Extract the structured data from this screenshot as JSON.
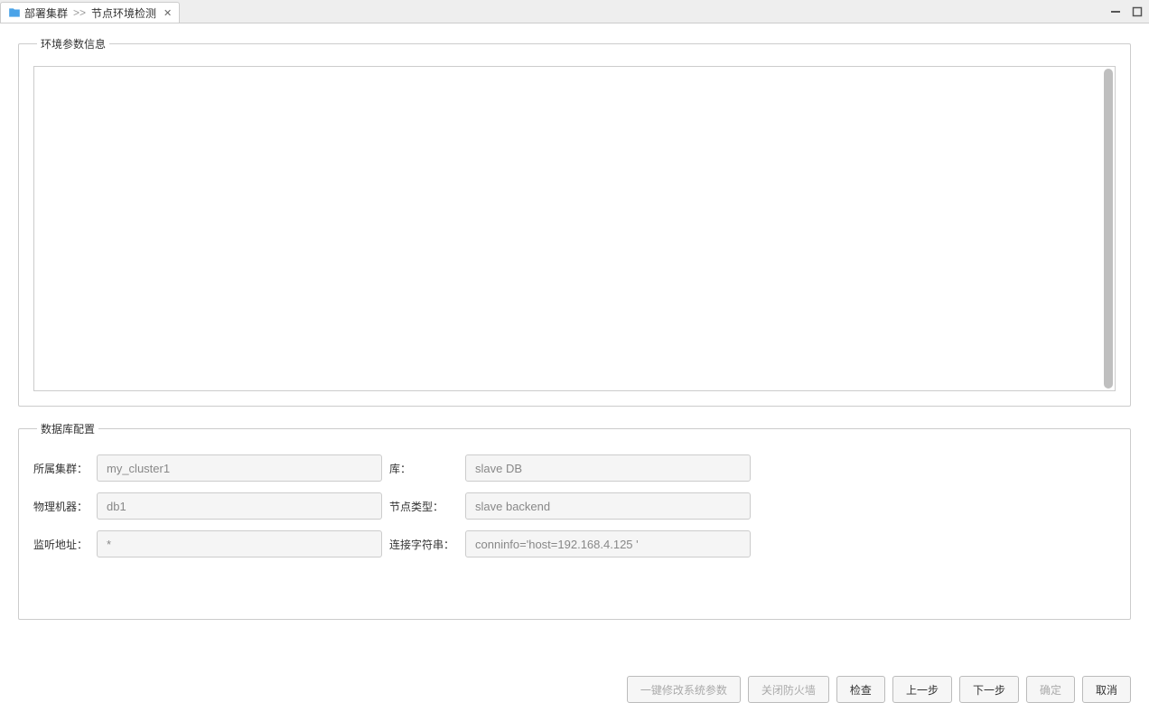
{
  "tab": {
    "breadcrumb_part1": "部署集群",
    "breadcrumb_sep": ">>",
    "breadcrumb_part2": "节点环境检测"
  },
  "env_section": {
    "legend": "环境参数信息"
  },
  "db_section": {
    "legend": "数据库配置",
    "fields": {
      "cluster_label": "所属集群：",
      "cluster_value": "my_cluster1",
      "db_label": "库：",
      "db_value": "slave DB",
      "machine_label": "物理机器：",
      "machine_value": "db1",
      "node_type_label": "节点类型：",
      "node_type_value": "slave backend",
      "listen_addr_label": "监听地址：",
      "listen_addr_value": "*",
      "conn_str_label": "连接字符串：",
      "conn_str_value": "conninfo='host=192.168.4.125 '"
    }
  },
  "buttons": {
    "modify_params": "一键修改系统参数",
    "close_firewall": "关闭防火墙",
    "check": "检查",
    "prev": "上一步",
    "next": "下一步",
    "ok": "确定",
    "cancel": "取消"
  }
}
